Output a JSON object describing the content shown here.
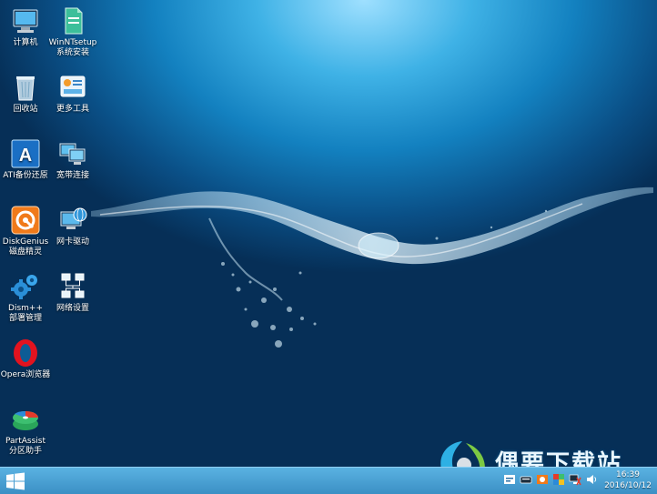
{
  "desktop_icons": [
    {
      "name": "icon-computer",
      "label": "计算机",
      "line2": ""
    },
    {
      "name": "icon-winntsetup",
      "label": "WinNTsetup",
      "line2": "系统安装"
    },
    {
      "name": "icon-recycle-bin",
      "label": "回收站",
      "line2": ""
    },
    {
      "name": "icon-more-tools",
      "label": "更多工具",
      "line2": ""
    },
    {
      "name": "icon-ati-backup",
      "label": "ATI备份还原",
      "line2": ""
    },
    {
      "name": "icon-broadband",
      "label": "宽带连接",
      "line2": ""
    },
    {
      "name": "icon-diskgenius",
      "label": "DiskGenius",
      "line2": "磁盘精灵"
    },
    {
      "name": "icon-nic-driver",
      "label": "网卡驱动",
      "line2": ""
    },
    {
      "name": "icon-dism",
      "label": "Dism++",
      "line2": "部署管理"
    },
    {
      "name": "icon-network-settings",
      "label": "网络设置",
      "line2": ""
    },
    {
      "name": "icon-opera",
      "label": "Opera浏览器",
      "line2": ""
    },
    {
      "name": "icon-partassist",
      "label": "PartAssist",
      "line2": "分区助手"
    }
  ],
  "taskbar": {
    "clock_time": "16:39",
    "clock_date": "2016/10/12"
  },
  "watermark": {
    "text": "偶要下载站"
  },
  "colors": {
    "taskbar": "#4aa2d6",
    "wallpaper_center": "#3fb2e6",
    "wallpaper_edge": "#062f57"
  }
}
